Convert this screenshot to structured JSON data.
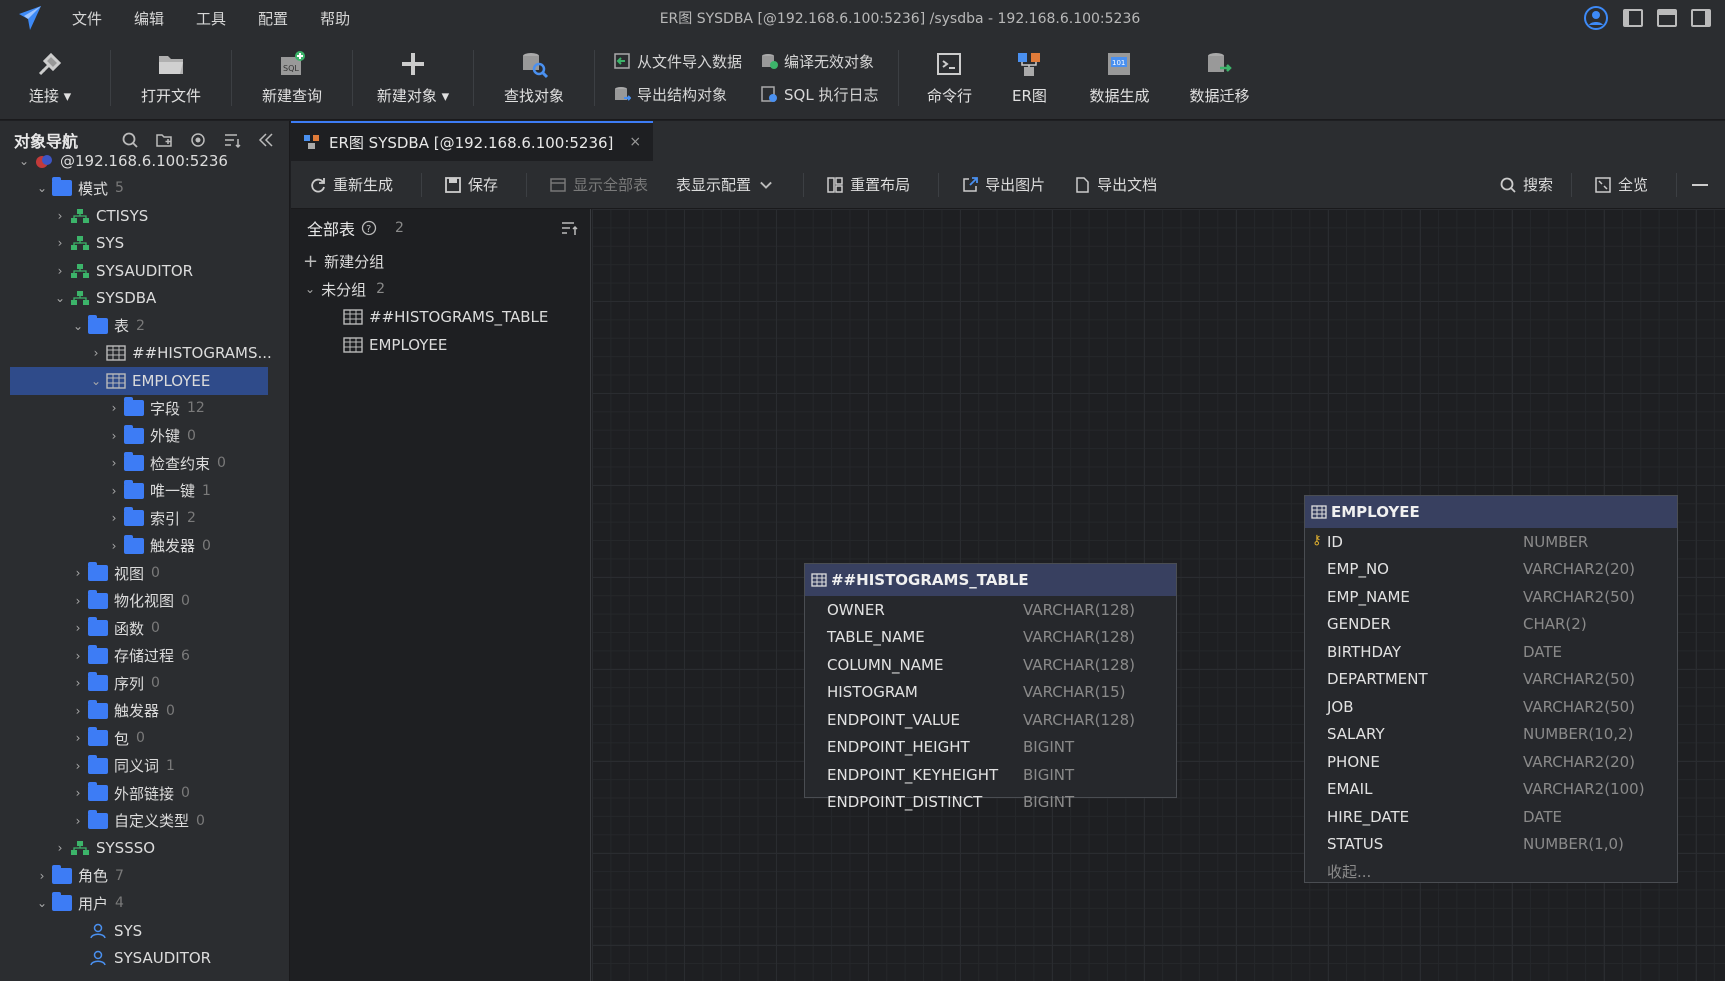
{
  "menu": [
    "文件",
    "编辑",
    "工具",
    "配置",
    "帮助"
  ],
  "window_title": "ER图 SYSDBA [@192.168.6.100:5236] /sysdba  - 192.168.6.100:5236",
  "toolbar": {
    "connect": "连接",
    "open_file": "打开文件",
    "new_query": "新建查询",
    "new_object": "新建对象",
    "find_object": "查找对象",
    "import_data": "从文件导入数据",
    "export_struct": "导出结构对象",
    "compile_invalid": "编译无效对象",
    "sql_log": "SQL 执行日志",
    "cmdline": "命令行",
    "er": "ER图",
    "data_gen": "数据生成",
    "data_migrate": "数据迁移"
  },
  "nav": {
    "title": "对象导航",
    "nodes": [
      {
        "label": "@192.168.6.100:5236",
        "indent": 0,
        "arrow": "⌄",
        "icon": "db"
      },
      {
        "label": "模式",
        "count": "5",
        "indent": 1,
        "arrow": "⌄",
        "icon": "folder"
      },
      {
        "label": "CTISYS",
        "indent": 2,
        "arrow": "›",
        "icon": "schema"
      },
      {
        "label": "SYS",
        "indent": 2,
        "arrow": "›",
        "icon": "schema"
      },
      {
        "label": "SYSAUDITOR",
        "indent": 2,
        "arrow": "›",
        "icon": "schema"
      },
      {
        "label": "SYSDBA",
        "indent": 2,
        "arrow": "⌄",
        "icon": "schema"
      },
      {
        "label": "表",
        "count": "2",
        "indent": 3,
        "arrow": "⌄",
        "icon": "folder"
      },
      {
        "label": "##HISTOGRAMS...",
        "indent": 4,
        "arrow": "›",
        "icon": "table"
      },
      {
        "label": "EMPLOYEE",
        "indent": 4,
        "arrow": "⌄",
        "icon": "table",
        "selected": true
      },
      {
        "label": "字段",
        "count": "12",
        "indent": 5,
        "arrow": "›",
        "icon": "folder"
      },
      {
        "label": "外键",
        "count": "0",
        "indent": 5,
        "arrow": "›",
        "icon": "folder"
      },
      {
        "label": "检查约束",
        "count": "0",
        "indent": 5,
        "arrow": "›",
        "icon": "folder"
      },
      {
        "label": "唯一键",
        "count": "1",
        "indent": 5,
        "arrow": "›",
        "icon": "folder"
      },
      {
        "label": "索引",
        "count": "2",
        "indent": 5,
        "arrow": "›",
        "icon": "folder"
      },
      {
        "label": "触发器",
        "count": "0",
        "indent": 5,
        "arrow": "›",
        "icon": "folder"
      },
      {
        "label": "视图",
        "count": "0",
        "indent": 3,
        "arrow": "›",
        "icon": "folder"
      },
      {
        "label": "物化视图",
        "count": "0",
        "indent": 3,
        "arrow": "›",
        "icon": "folder"
      },
      {
        "label": "函数",
        "count": "0",
        "indent": 3,
        "arrow": "›",
        "icon": "folder"
      },
      {
        "label": "存储过程",
        "count": "6",
        "indent": 3,
        "arrow": "›",
        "icon": "folder"
      },
      {
        "label": "序列",
        "count": "0",
        "indent": 3,
        "arrow": "›",
        "icon": "folder"
      },
      {
        "label": "触发器",
        "count": "0",
        "indent": 3,
        "arrow": "›",
        "icon": "folder"
      },
      {
        "label": "包",
        "count": "0",
        "indent": 3,
        "arrow": "›",
        "icon": "folder"
      },
      {
        "label": "同义词",
        "count": "1",
        "indent": 3,
        "arrow": "›",
        "icon": "folder"
      },
      {
        "label": "外部链接",
        "count": "0",
        "indent": 3,
        "arrow": "›",
        "icon": "folder"
      },
      {
        "label": "自定义类型",
        "count": "0",
        "indent": 3,
        "arrow": "›",
        "icon": "folder"
      },
      {
        "label": "SYSSSO",
        "indent": 2,
        "arrow": "›",
        "icon": "schema"
      },
      {
        "label": "角色",
        "count": "7",
        "indent": 1,
        "arrow": "›",
        "icon": "folder"
      },
      {
        "label": "用户",
        "count": "4",
        "indent": 1,
        "arrow": "⌄",
        "icon": "folder"
      },
      {
        "label": "SYS",
        "indent": 3,
        "arrow": "",
        "icon": "user"
      },
      {
        "label": "SYSAUDITOR",
        "indent": 3,
        "arrow": "",
        "icon": "user"
      }
    ]
  },
  "tab": {
    "label": "ER图 SYSDBA [@192.168.6.100:5236]",
    "close": "×"
  },
  "er_toolbar": {
    "regenerate": "重新生成",
    "save": "保存",
    "show_all": "显示全部表",
    "display_config": "表显示配置",
    "relayout": "重置布局",
    "export_image": "导出图片",
    "export_doc": "导出文档",
    "search": "搜索",
    "overview": "全览"
  },
  "tables_panel": {
    "title": "全部表",
    "count": "2",
    "new_group": "新建分组",
    "ungrouped": "未分组",
    "ungrouped_count": "2",
    "items": [
      "##HISTOGRAMS_TABLE",
      "EMPLOYEE"
    ]
  },
  "entities": [
    {
      "name": "##HISTOGRAMS_TABLE",
      "fields": [
        {
          "name": "OWNER",
          "type": "VARCHAR(128)"
        },
        {
          "name": "TABLE_NAME",
          "type": "VARCHAR(128)"
        },
        {
          "name": "COLUMN_NAME",
          "type": "VARCHAR(128)"
        },
        {
          "name": "HISTOGRAM",
          "type": "VARCHAR(15)"
        },
        {
          "name": "ENDPOINT_VALUE",
          "type": "VARCHAR(128)"
        },
        {
          "name": "ENDPOINT_HEIGHT",
          "type": "BIGINT"
        },
        {
          "name": "ENDPOINT_KEYHEIGHT",
          "type": "BIGINT"
        },
        {
          "name": "ENDPOINT_DISTINCT",
          "type": "BIGINT"
        }
      ]
    },
    {
      "name": "EMPLOYEE",
      "collapse": "收起...",
      "fields": [
        {
          "name": "ID",
          "type": "NUMBER",
          "pk": true
        },
        {
          "name": "EMP_NO",
          "type": "VARCHAR2(20)"
        },
        {
          "name": "EMP_NAME",
          "type": "VARCHAR2(50)"
        },
        {
          "name": "GENDER",
          "type": "CHAR(2)"
        },
        {
          "name": "BIRTHDAY",
          "type": "DATE"
        },
        {
          "name": "DEPARTMENT",
          "type": "VARCHAR2(50)"
        },
        {
          "name": "JOB",
          "type": "VARCHAR2(50)"
        },
        {
          "name": "SALARY",
          "type": "NUMBER(10,2)"
        },
        {
          "name": "PHONE",
          "type": "VARCHAR2(20)"
        },
        {
          "name": "EMAIL",
          "type": "VARCHAR2(100)"
        },
        {
          "name": "HIRE_DATE",
          "type": "DATE"
        },
        {
          "name": "STATUS",
          "type": "NUMBER(1,0)"
        }
      ]
    }
  ]
}
